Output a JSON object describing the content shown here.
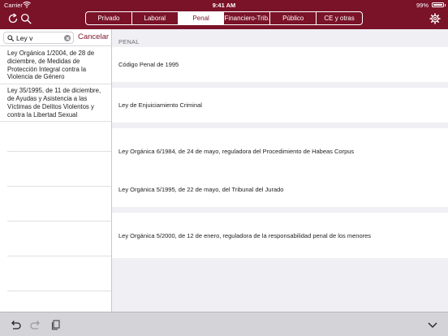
{
  "status_bar": {
    "carrier": "Carrier",
    "time": "9:41 AM",
    "battery": "99%"
  },
  "nav": {
    "icons": [
      "refresh-icon",
      "search-icon",
      "settings-icon"
    ],
    "tabs": [
      {
        "label": "Privado",
        "active": false
      },
      {
        "label": "Laboral",
        "active": false
      },
      {
        "label": "Penal",
        "active": true
      },
      {
        "label": "Financiero-Trib.",
        "active": false
      },
      {
        "label": "Público",
        "active": false
      },
      {
        "label": "CE y otras",
        "active": false
      }
    ]
  },
  "search": {
    "value": "Ley v",
    "cancel_label": "Cancelar"
  },
  "results": [
    {
      "text": "Ley Orgánica 1/2004, de 28 de diciembre, de Medidas de Protección Integral contra la Violencia de Género"
    },
    {
      "text": "Ley 35/1995, de 11 de diciembre, de Ayudas y Asistencia a las Víctimas de Delitos Violentos y contra la Libertad Sexual"
    }
  ],
  "main": {
    "section_header": "PENAL",
    "laws": [
      {
        "title": "Código Penal de 1995"
      },
      {
        "title": "Ley de Enjuiciamiento Criminal"
      },
      {
        "title": "Ley Orgánica 6/1984, de 24 de mayo, reguladora del Procedimiento de Habeas Corpus"
      },
      {
        "title": "Ley Orgánica 5/1995, de 22 de mayo, del Tribunal del Jurado"
      },
      {
        "title": "Ley Orgánica 5/2000, de 12 de enero, reguladora de la responsabilidad penal de los menores"
      }
    ]
  },
  "toolbar": {
    "icons": [
      "undo-icon",
      "redo-icon",
      "copy-icon",
      "chevron-down-icon"
    ]
  },
  "colors": {
    "brand": "#7a1228",
    "background": "#efeff4",
    "toolbar": "#d4d4d8"
  }
}
